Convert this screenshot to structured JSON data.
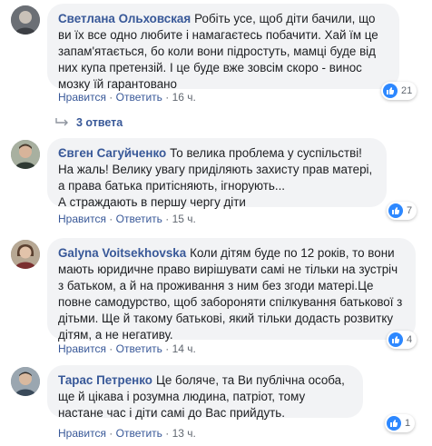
{
  "comments": [
    {
      "author": "Светлана Ольховская",
      "text": "Робіть усе, щоб діти бачили, що ви їх все одно любите і намагаєтесь побачити. Хай їм це запам'ятається, бо коли вони підростуть, мамці буде від них купа претензій. І це буде вже зовсім скоро - винос мозку їй гарантовано",
      "like_label": "Нравится",
      "reply_label": "Ответить",
      "time": "16 ч.",
      "reactions": "21",
      "replies_label": "3 ответа"
    },
    {
      "author": "Євген Сагуйченко",
      "text": "То велика проблема у суспільстві! На жаль! Велику увагу приділяють захисту прав матері, а права батька притісняють, ігнорують...\nА страждають в першу чергу діти",
      "like_label": "Нравится",
      "reply_label": "Ответить",
      "time": "15 ч.",
      "reactions": "7"
    },
    {
      "author": "Galyna Voitsekhovska",
      "text": "Коли дітям буде по 12 років, то вони мають юридичне право вирішувати самі не тільки на зустріч з батьком, а й на проживання з ним без згоди матері.Це повне самодурство, щоб забороняти спілкування батькової з дітьми. Ще й такому батькові, який тільки додасть розвитку дітям, а не негативу.",
      "like_label": "Нравится",
      "reply_label": "Ответить",
      "time": "14 ч.",
      "reactions": "4"
    },
    {
      "author": "Тарас Петренко",
      "text": "Це боляче, та Ви публічна особа, ще й цікава і розумна людина, патріот, тому настане час і діти самі до Вас прийдуть.",
      "like_label": "Нравится",
      "reply_label": "Ответить",
      "time": "13 ч.",
      "reactions": "1"
    }
  ],
  "colors": {
    "author": "#385898",
    "bubble": "#f2f3f5",
    "like": "#2d88ff",
    "meta": "#606770"
  }
}
